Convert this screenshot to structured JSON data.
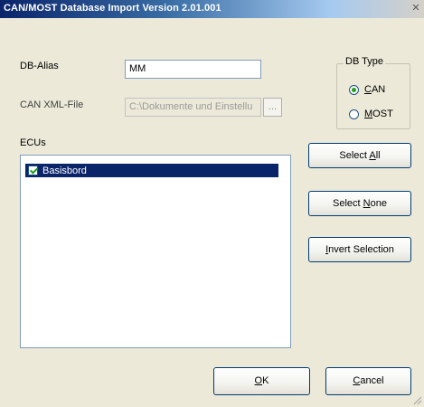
{
  "window": {
    "title": "CAN/MOST Database Import Version 2.01.001",
    "close_glyph": "✕"
  },
  "db_alias": {
    "label": "DB-Alias",
    "value": "MM"
  },
  "can_xml_file": {
    "label": "CAN XML-File",
    "value": "C:\\Dokumente und Einstellu",
    "browse_label": "..."
  },
  "db_type": {
    "legend": "DB Type",
    "options": [
      {
        "label_underlined": "C",
        "label_rest": "AN",
        "checked": true
      },
      {
        "label_underlined": "M",
        "label_rest": "OST",
        "checked": false
      }
    ]
  },
  "ecus": {
    "label": "ECUs",
    "items": [
      {
        "label": "Basisbord",
        "checked": true,
        "selected": true
      }
    ]
  },
  "buttons": {
    "select_all": {
      "pre": "Select ",
      "ul": "A",
      "post": "ll"
    },
    "select_none": {
      "pre": "Select ",
      "ul": "N",
      "post": "one"
    },
    "invert_selection": {
      "pre": "",
      "ul": "I",
      "post": "nvert Selection"
    },
    "ok": {
      "pre": "",
      "ul": "O",
      "post": "K"
    },
    "cancel": {
      "pre": "",
      "ul": "C",
      "post": "ancel"
    }
  },
  "colors": {
    "title_bar_start": "#0a246a",
    "selection": "#0a246a",
    "dialog_background": "#ece9d8",
    "radio_dot": "#21a121",
    "check_mark": "#21a121"
  }
}
